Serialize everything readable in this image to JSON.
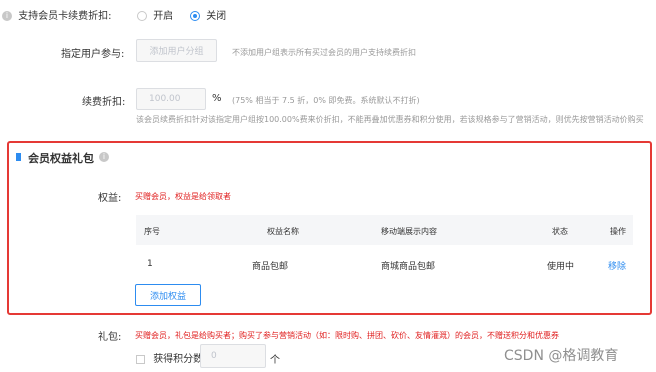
{
  "renew_discount": {
    "label": "支持会员卡续费折扣:",
    "option_on": "开启",
    "option_off": "关闭"
  },
  "user_group": {
    "label": "指定用户参与:",
    "button": "添加用户分组",
    "hint": "不添加用户组表示所有买过会员的用户支持续费折扣"
  },
  "renew_fold": {
    "label": "续费折扣:",
    "value": "100.00",
    "unit": "%",
    "hint": "(75% 相当于 7.5 折，0% 即免费。系统默认不打折)",
    "desc": "该会员续费折扣针对该指定用户组按100.00%费来价折扣，不能再叠加优惠券和积分使用，若该规格参与了营销活动，则优先按营销活动价购买"
  },
  "gift_section": {
    "title": "会员权益礼包",
    "rights_label": "权益:",
    "rights_desc": "买赠会员，权益是给领取者",
    "table": {
      "headers": [
        "序号",
        "权益名称",
        "移动端展示内容",
        "状态",
        "操作"
      ],
      "rows": [
        {
          "index": "1",
          "name": "商品包邮",
          "mobile": "商城商品包邮",
          "status": "使用中",
          "action": "移除"
        }
      ]
    },
    "add_button": "添加权益"
  },
  "gift": {
    "label": "礼包:",
    "desc": "买赠会员，礼包是给购买者；购买了参与营销活动（如：限时购、拼团、砍价、友情灌溉）的会员，不赠送积分和优惠券",
    "points_label": "获得积分数",
    "points_value": "0",
    "points_unit": "个"
  },
  "watermark": "CSDN @格调教育",
  "colors": {
    "accent": "#2d8cf0",
    "highlight_border": "#e53935",
    "warning_text": "#e02020"
  }
}
